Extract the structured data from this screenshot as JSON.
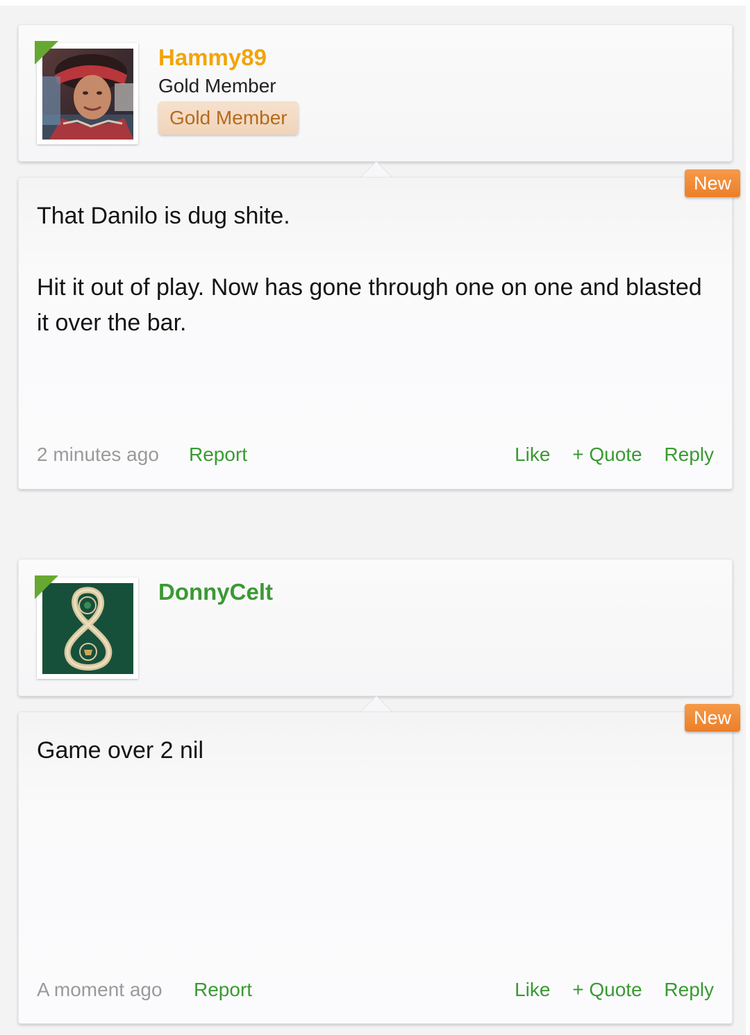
{
  "posts": [
    {
      "username": "Hammy89",
      "username_color": "#f2a40b",
      "rank_text": "Gold Member",
      "rank_badge": "Gold Member",
      "avatar": "user-photo",
      "new_badge": "New",
      "message": [
        "That Danilo is dug shite.",
        "Hit it out of play. Now has gone through one on one and blasted it over the bar."
      ],
      "time": "2 minutes ago",
      "report": "Report",
      "like": "Like",
      "quote": "+ Quote",
      "reply": "Reply"
    },
    {
      "username": "DonnyCelt",
      "username_color": "#3a9a32",
      "avatar": "green-8-emblem",
      "new_badge": "New",
      "message": [
        "Game over 2 nil"
      ],
      "time": "A moment ago",
      "report": "Report",
      "like": "Like",
      "quote": "+ Quote",
      "reply": "Reply"
    }
  ],
  "colors": {
    "accent_green": "#3a9a32",
    "new_badge": "#ec7f28",
    "rank_badge_text": "#b56a1e"
  }
}
